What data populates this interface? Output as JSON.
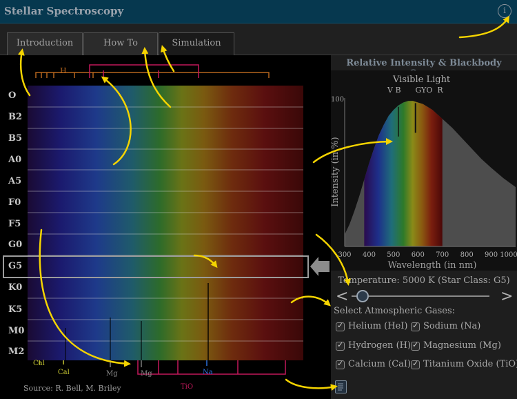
{
  "app": {
    "title": "Stellar Spectroscopy",
    "info_icon": "info-icon",
    "info_glyph": "i"
  },
  "tabs": [
    {
      "label": "Introduction",
      "active": false
    },
    {
      "label": "How To",
      "active": false
    },
    {
      "label": "Simulation",
      "active": true
    }
  ],
  "spectra": {
    "star_classes": [
      "O",
      "B2",
      "B5",
      "A0",
      "A5",
      "F0",
      "F5",
      "G0",
      "G5",
      "K0",
      "K5",
      "M0",
      "M2"
    ],
    "selected_class": "G5",
    "top_element_label": "H",
    "bottom_element_labels": [
      "Cal",
      "Cal",
      "Mg",
      "Mg",
      "Na",
      "TiO"
    ],
    "source": "Source: R. Bell, M. Briley"
  },
  "chart_panel": {
    "title": "Relative Intensity & Blackbody Curve",
    "visible_light_label": "Visible Light",
    "color_band_labels": "V B      GYO  R",
    "ylabel": "Intensity (in %)",
    "xlabel": "Wavelength (in nm)",
    "y_tick": "100",
    "x_ticks": [
      "300",
      "400",
      "500",
      "600",
      "700",
      "800",
      "900",
      "1000"
    ]
  },
  "chart_data": {
    "type": "area",
    "title": "Relative Intensity & Blackbody Curve",
    "xlabel": "Wavelength (in nm)",
    "ylabel": "Intensity (in %)",
    "xlim": [
      300,
      1000
    ],
    "ylim": [
      0,
      100
    ],
    "visible_band": [
      380,
      700
    ],
    "series": [
      {
        "x": [
          300,
          320,
          340,
          360,
          380,
          400,
          420,
          440,
          460,
          480,
          500,
          520,
          540,
          560,
          580,
          600,
          620,
          640,
          660,
          680,
          700,
          740,
          780,
          820,
          860,
          900,
          950,
          1000
        ],
        "values": [
          8,
          15,
          24,
          34,
          45,
          56,
          66,
          75,
          82,
          88,
          92,
          95,
          97,
          98,
          98,
          97,
          96,
          94,
          92,
          89,
          86,
          80,
          73,
          66,
          59,
          53,
          46,
          40
        ]
      }
    ],
    "absorption_lines_nm": [
      520,
      590
    ]
  },
  "controls": {
    "temperature_text": "Temperature: 5000 K (Star Class: G5)",
    "prev_icon": "chevron-left-icon",
    "next_icon": "chevron-right-icon",
    "prev_glyph": "<",
    "next_glyph": ">",
    "slider_value_fraction": 0.08,
    "gases_label": "Select Atmospheric Gases:",
    "gases": [
      {
        "label": "Helium (HeI)",
        "checked": true
      },
      {
        "label": "Sodium (Na)",
        "checked": true
      },
      {
        "label": "Hydrogen (H)",
        "checked": true
      },
      {
        "label": "Magnesium (Mg)",
        "checked": true
      },
      {
        "label": "Calcium (CaI)",
        "checked": true
      },
      {
        "label": "Titanium Oxide (TiO)",
        "checked": true
      }
    ],
    "doc_icon": "document-icon"
  },
  "colors": {
    "title_bar": "#06384f",
    "annotation_arrow": "#f5d400",
    "panel_bg": "#1e1e1e"
  }
}
